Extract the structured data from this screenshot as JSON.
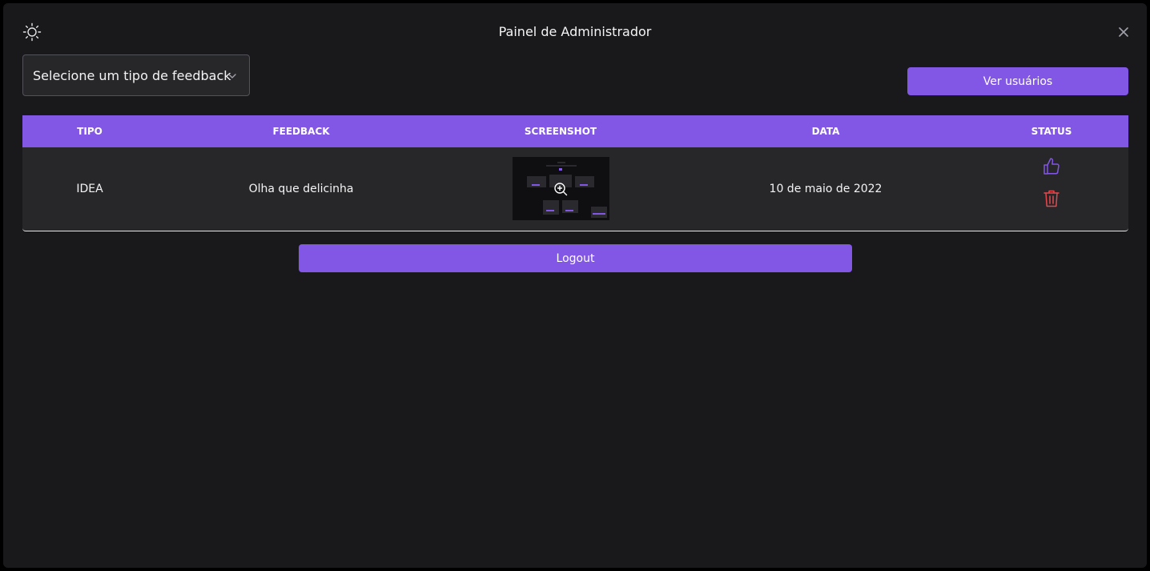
{
  "window": {
    "title": "Painel de Administrador",
    "theme_icon": "sun-icon",
    "close_icon": "close-icon"
  },
  "filter": {
    "selected": "Selecione um tipo de feedback",
    "icon": "chevron-down-icon"
  },
  "actions": {
    "users_label": "Ver usuários",
    "logout_label": "Logout"
  },
  "table": {
    "headers": {
      "type": "TIPO",
      "feedback": "FEEDBACK",
      "screenshot": "SCREENSHOT",
      "date": "DATA",
      "status": "STATUS"
    },
    "rows": [
      {
        "type": "IDEA",
        "feedback": "Olha que delicinha",
        "screenshot_icon": "zoom-in-icon",
        "date": "10 de maio de 2022",
        "status_icons": [
          "thumbs-up-icon",
          "trash-icon"
        ]
      }
    ]
  },
  "colors": {
    "accent": "#8257e5",
    "background": "#19191c",
    "row_background": "#27272a",
    "delete": "#e5484d",
    "text": "#f4f4f5"
  }
}
